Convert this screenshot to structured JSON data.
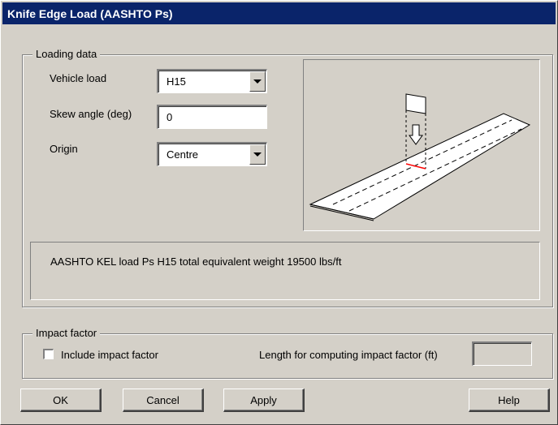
{
  "window": {
    "title": "Knife Edge Load (AASHTO Ps)"
  },
  "loading_data": {
    "group_title": "Loading data",
    "vehicle_load": {
      "label": "Vehicle load",
      "value": "H15"
    },
    "skew_angle": {
      "label": "Skew angle (deg)",
      "value": "0"
    },
    "origin": {
      "label": "Origin",
      "value": "Centre"
    },
    "description": "AASHTO KEL load Ps H15 total equivalent weight 19500 lbs/ft"
  },
  "impact_factor": {
    "group_title": "Impact factor",
    "include_label": "Include impact factor",
    "include_checked": false,
    "length_label": "Length for computing impact factor (ft)",
    "length_value": ""
  },
  "buttons": {
    "ok": "OK",
    "cancel": "Cancel",
    "apply": "Apply",
    "help": "Help"
  },
  "colors": {
    "titlebar": "#0a246a",
    "face": "#d4d0c8",
    "load_marker": "#ff0000"
  }
}
